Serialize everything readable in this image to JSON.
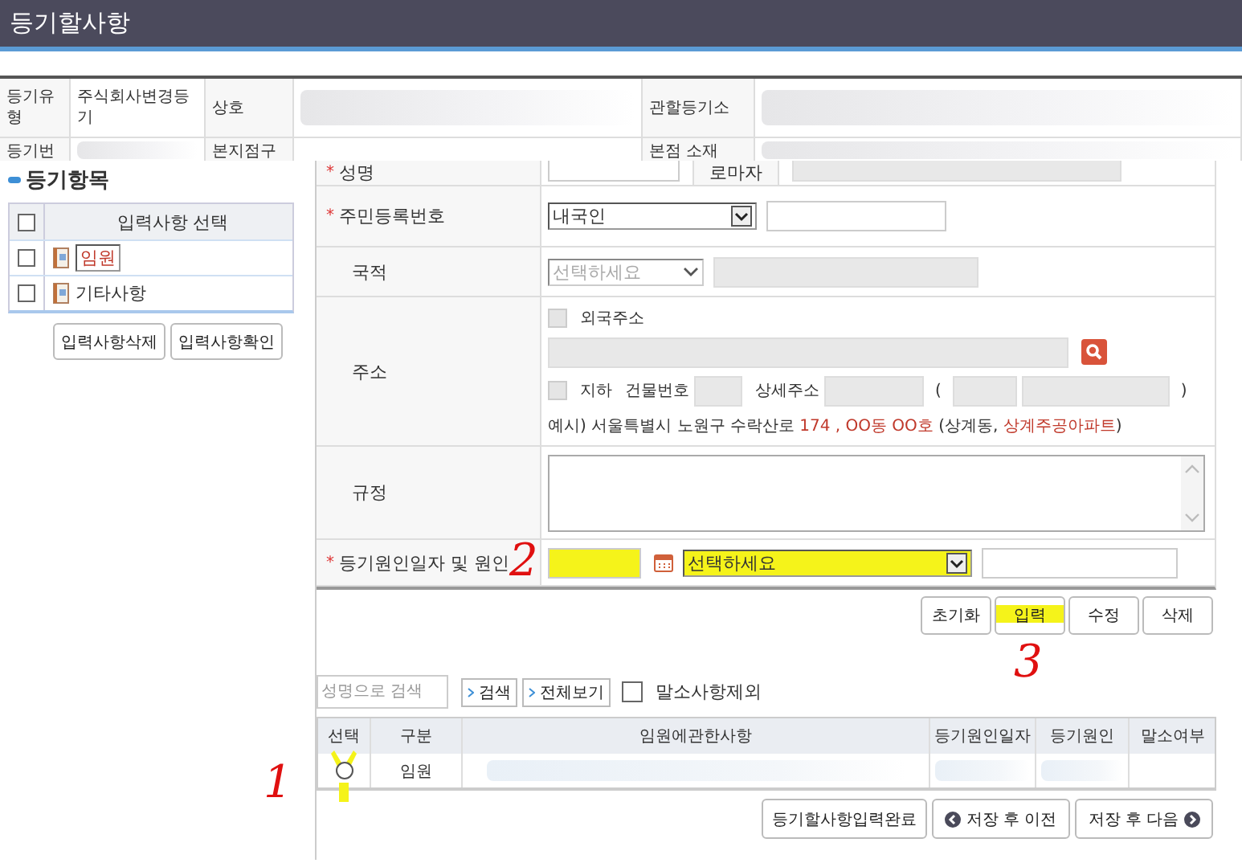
{
  "window": {
    "title": "등기할사항"
  },
  "summary": {
    "rows": [
      {
        "cells": [
          {
            "kind": "label",
            "text": "등기유형"
          },
          {
            "kind": "value",
            "text": "주식회사변경등기"
          },
          {
            "kind": "label",
            "text": "상호"
          },
          {
            "kind": "redacted"
          },
          {
            "kind": "label",
            "text": "관할등기소"
          },
          {
            "kind": "redacted"
          }
        ]
      },
      {
        "cells": [
          {
            "kind": "label",
            "text": "등기번"
          },
          {
            "kind": "redacted"
          },
          {
            "kind": "label",
            "text": "본지점구"
          },
          {
            "kind": "empty"
          },
          {
            "kind": "label",
            "text": "본점 소재"
          },
          {
            "kind": "redacted"
          }
        ]
      }
    ]
  },
  "sidebar": {
    "heading": "등기항목",
    "header": "입력사항 선택",
    "all_checked": false,
    "items": [
      {
        "label": "임원",
        "checked": false,
        "selected": true
      },
      {
        "label": "기타사항",
        "checked": false,
        "selected": false
      }
    ],
    "buttons": [
      "입력사항삭제",
      "입력사항확인"
    ]
  },
  "form": [
    {
      "kind": "name",
      "mark": "*",
      "label": "성명",
      "roman_label": "로마자"
    },
    {
      "kind": "id",
      "mark": "*",
      "label": "주민등록번호",
      "select": "내국인"
    },
    {
      "kind": "nationality",
      "label": "국적",
      "placeholder": "선택하세요"
    },
    {
      "kind": "address",
      "label": "주소",
      "foreign_label": "외국주소",
      "foreign_checked": false,
      "basement_label": "지하",
      "basement_checked": false,
      "building_label": "건물번호",
      "detail_label": "상세주소",
      "paren_open": "(",
      "paren_close": ")",
      "example": [
        {
          "text": "예시) 서울특별시 노원구 수락산로 ",
          "emphasis": false
        },
        {
          "text": "174 , OO동 OO호",
          "emphasis": true
        },
        {
          "text": " (상계동, ",
          "emphasis": false
        },
        {
          "text": "상계주공아파트",
          "emphasis": true
        },
        {
          "text": ")",
          "emphasis": false
        }
      ]
    },
    {
      "kind": "rules",
      "label": "규정"
    },
    {
      "kind": "cause",
      "mark": "*",
      "label": "등기원인일자 및 원인",
      "select": "선택하세요",
      "highlight": true,
      "annotation": "2"
    }
  ],
  "actions": [
    {
      "label": "초기화",
      "highlight": false
    },
    {
      "label": "입력",
      "highlight": true,
      "annotation": "3"
    },
    {
      "label": "수정",
      "highlight": false
    },
    {
      "label": "삭제",
      "highlight": false
    }
  ],
  "search": {
    "placeholder": "성명으로 검색",
    "buttons": [
      "검색",
      "전체보기"
    ],
    "exclude_label": "말소사항제외",
    "exclude_checked": false
  },
  "results": {
    "columns": [
      "선택",
      "구분",
      "임원에관한사항",
      "등기원인일자",
      "등기원인",
      "말소여부"
    ],
    "rows": [
      {
        "selected": false,
        "highlight": true,
        "annotation": "1",
        "type": "임원"
      }
    ]
  },
  "footer_buttons": [
    {
      "label": "등기할사항입력완료"
    },
    {
      "label": "저장 후 이전",
      "kind": "prev"
    },
    {
      "label": "저장 후 다음",
      "kind": "next"
    }
  ]
}
